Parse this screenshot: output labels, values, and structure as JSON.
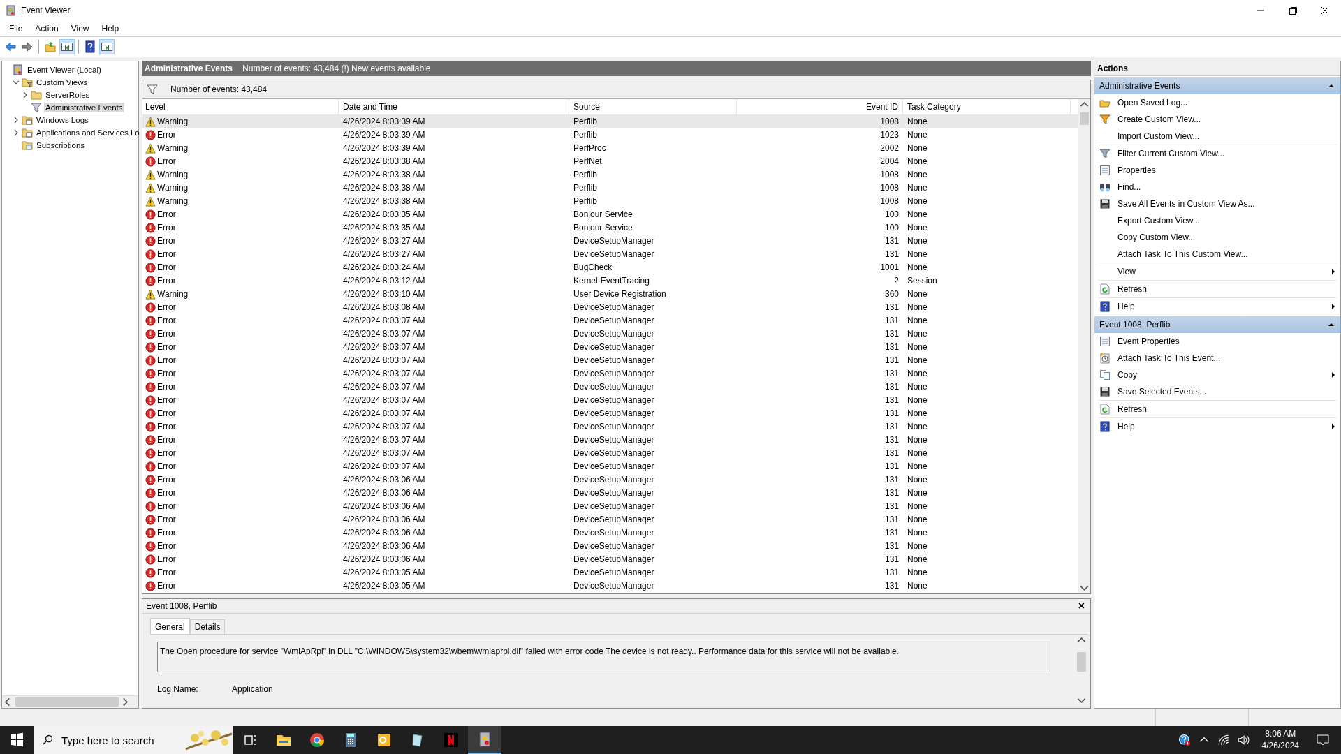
{
  "window": {
    "title": "Event Viewer"
  },
  "menu": [
    "File",
    "Action",
    "View",
    "Help"
  ],
  "toolbar": [
    {
      "kind": "back",
      "pressed": false
    },
    {
      "kind": "forward",
      "pressed": false
    },
    {
      "kind": "up",
      "pressed": false
    },
    {
      "kind": "tree",
      "pressed": true
    },
    {
      "kind": "help",
      "pressed": false
    },
    {
      "kind": "actionpane",
      "pressed": true
    }
  ],
  "tree": [
    {
      "label": "Event Viewer (Local)",
      "kind": "viewer",
      "selected": false,
      "children": [
        {
          "label": "Custom Views",
          "kind": "folderfilter",
          "expanded": true,
          "selected": false,
          "children": [
            {
              "label": "ServerRoles",
              "kind": "folder",
              "expanded": false,
              "selected": false
            },
            {
              "label": "Administrative Events",
              "kind": "filter",
              "selected": true
            }
          ]
        },
        {
          "label": "Windows Logs",
          "kind": "folderlog",
          "expanded": false,
          "selected": false
        },
        {
          "label": "Applications and Services Lo",
          "kind": "folderlog",
          "expanded": false,
          "selected": false
        },
        {
          "label": "Subscriptions",
          "kind": "foldersub",
          "selected": false
        }
      ]
    }
  ],
  "center": {
    "title": "Administrative Events",
    "subtitle": "Number of events: 43,484 (!) New events available",
    "filter_text": "Number of events: 43,484"
  },
  "table": {
    "columns": [
      "Level",
      "Date and Time",
      "Source",
      "Event ID",
      "Task Category"
    ],
    "rows": [
      {
        "kind": "warning",
        "level": "Warning",
        "date": "4/26/2024 8:03:39 AM",
        "source": "Perflib",
        "id": "1008",
        "task": "None",
        "selected": true
      },
      {
        "kind": "error",
        "level": "Error",
        "date": "4/26/2024 8:03:39 AM",
        "source": "Perflib",
        "id": "1023",
        "task": "None",
        "selected": false
      },
      {
        "kind": "warning",
        "level": "Warning",
        "date": "4/26/2024 8:03:39 AM",
        "source": "PerfProc",
        "id": "2002",
        "task": "None",
        "selected": false
      },
      {
        "kind": "error",
        "level": "Error",
        "date": "4/26/2024 8:03:38 AM",
        "source": "PerfNet",
        "id": "2004",
        "task": "None",
        "selected": false
      },
      {
        "kind": "warning",
        "level": "Warning",
        "date": "4/26/2024 8:03:38 AM",
        "source": "Perflib",
        "id": "1008",
        "task": "None",
        "selected": false
      },
      {
        "kind": "warning",
        "level": "Warning",
        "date": "4/26/2024 8:03:38 AM",
        "source": "Perflib",
        "id": "1008",
        "task": "None",
        "selected": false
      },
      {
        "kind": "warning",
        "level": "Warning",
        "date": "4/26/2024 8:03:38 AM",
        "source": "Perflib",
        "id": "1008",
        "task": "None",
        "selected": false
      },
      {
        "kind": "error",
        "level": "Error",
        "date": "4/26/2024 8:03:35 AM",
        "source": "Bonjour Service",
        "id": "100",
        "task": "None",
        "selected": false
      },
      {
        "kind": "error",
        "level": "Error",
        "date": "4/26/2024 8:03:35 AM",
        "source": "Bonjour Service",
        "id": "100",
        "task": "None",
        "selected": false
      },
      {
        "kind": "error",
        "level": "Error",
        "date": "4/26/2024 8:03:27 AM",
        "source": "DeviceSetupManager",
        "id": "131",
        "task": "None",
        "selected": false
      },
      {
        "kind": "error",
        "level": "Error",
        "date": "4/26/2024 8:03:27 AM",
        "source": "DeviceSetupManager",
        "id": "131",
        "task": "None",
        "selected": false
      },
      {
        "kind": "error",
        "level": "Error",
        "date": "4/26/2024 8:03:24 AM",
        "source": "BugCheck",
        "id": "1001",
        "task": "None",
        "selected": false
      },
      {
        "kind": "error",
        "level": "Error",
        "date": "4/26/2024 8:03:12 AM",
        "source": "Kernel-EventTracing",
        "id": "2",
        "task": "Session",
        "selected": false
      },
      {
        "kind": "warning",
        "level": "Warning",
        "date": "4/26/2024 8:03:10 AM",
        "source": "User Device Registration",
        "id": "360",
        "task": "None",
        "selected": false
      },
      {
        "kind": "error",
        "level": "Error",
        "date": "4/26/2024 8:03:08 AM",
        "source": "DeviceSetupManager",
        "id": "131",
        "task": "None",
        "selected": false
      },
      {
        "kind": "error",
        "level": "Error",
        "date": "4/26/2024 8:03:07 AM",
        "source": "DeviceSetupManager",
        "id": "131",
        "task": "None",
        "selected": false
      },
      {
        "kind": "error",
        "level": "Error",
        "date": "4/26/2024 8:03:07 AM",
        "source": "DeviceSetupManager",
        "id": "131",
        "task": "None",
        "selected": false
      },
      {
        "kind": "error",
        "level": "Error",
        "date": "4/26/2024 8:03:07 AM",
        "source": "DeviceSetupManager",
        "id": "131",
        "task": "None",
        "selected": false
      },
      {
        "kind": "error",
        "level": "Error",
        "date": "4/26/2024 8:03:07 AM",
        "source": "DeviceSetupManager",
        "id": "131",
        "task": "None",
        "selected": false
      },
      {
        "kind": "error",
        "level": "Error",
        "date": "4/26/2024 8:03:07 AM",
        "source": "DeviceSetupManager",
        "id": "131",
        "task": "None",
        "selected": false
      },
      {
        "kind": "error",
        "level": "Error",
        "date": "4/26/2024 8:03:07 AM",
        "source": "DeviceSetupManager",
        "id": "131",
        "task": "None",
        "selected": false
      },
      {
        "kind": "error",
        "level": "Error",
        "date": "4/26/2024 8:03:07 AM",
        "source": "DeviceSetupManager",
        "id": "131",
        "task": "None",
        "selected": false
      },
      {
        "kind": "error",
        "level": "Error",
        "date": "4/26/2024 8:03:07 AM",
        "source": "DeviceSetupManager",
        "id": "131",
        "task": "None",
        "selected": false
      },
      {
        "kind": "error",
        "level": "Error",
        "date": "4/26/2024 8:03:07 AM",
        "source": "DeviceSetupManager",
        "id": "131",
        "task": "None",
        "selected": false
      },
      {
        "kind": "error",
        "level": "Error",
        "date": "4/26/2024 8:03:07 AM",
        "source": "DeviceSetupManager",
        "id": "131",
        "task": "None",
        "selected": false
      },
      {
        "kind": "error",
        "level": "Error",
        "date": "4/26/2024 8:03:07 AM",
        "source": "DeviceSetupManager",
        "id": "131",
        "task": "None",
        "selected": false
      },
      {
        "kind": "error",
        "level": "Error",
        "date": "4/26/2024 8:03:07 AM",
        "source": "DeviceSetupManager",
        "id": "131",
        "task": "None",
        "selected": false
      },
      {
        "kind": "error",
        "level": "Error",
        "date": "4/26/2024 8:03:06 AM",
        "source": "DeviceSetupManager",
        "id": "131",
        "task": "None",
        "selected": false
      },
      {
        "kind": "error",
        "level": "Error",
        "date": "4/26/2024 8:03:06 AM",
        "source": "DeviceSetupManager",
        "id": "131",
        "task": "None",
        "selected": false
      },
      {
        "kind": "error",
        "level": "Error",
        "date": "4/26/2024 8:03:06 AM",
        "source": "DeviceSetupManager",
        "id": "131",
        "task": "None",
        "selected": false
      },
      {
        "kind": "error",
        "level": "Error",
        "date": "4/26/2024 8:03:06 AM",
        "source": "DeviceSetupManager",
        "id": "131",
        "task": "None",
        "selected": false
      },
      {
        "kind": "error",
        "level": "Error",
        "date": "4/26/2024 8:03:06 AM",
        "source": "DeviceSetupManager",
        "id": "131",
        "task": "None",
        "selected": false
      },
      {
        "kind": "error",
        "level": "Error",
        "date": "4/26/2024 8:03:06 AM",
        "source": "DeviceSetupManager",
        "id": "131",
        "task": "None",
        "selected": false
      },
      {
        "kind": "error",
        "level": "Error",
        "date": "4/26/2024 8:03:06 AM",
        "source": "DeviceSetupManager",
        "id": "131",
        "task": "None",
        "selected": false
      },
      {
        "kind": "error",
        "level": "Error",
        "date": "4/26/2024 8:03:05 AM",
        "source": "DeviceSetupManager",
        "id": "131",
        "task": "None",
        "selected": false
      },
      {
        "kind": "error",
        "level": "Error",
        "date": "4/26/2024 8:03:05 AM",
        "source": "DeviceSetupManager",
        "id": "131",
        "task": "None",
        "selected": false
      }
    ]
  },
  "details": {
    "title": "Event 1008, Perflib",
    "close": "×",
    "tabs": [
      {
        "label": "General",
        "selected": true
      },
      {
        "label": "Details",
        "selected": false
      }
    ],
    "message": "The Open procedure for service \"WmiApRpl\" in DLL \"C:\\WINDOWS\\system32\\wbem\\wmiaprpl.dll\" failed with error code The device is not ready.. Performance data for this service will not be available.",
    "log_label": "Log Name:",
    "log_value": "Application"
  },
  "actions": {
    "title": "Actions",
    "sections": [
      {
        "title": "Administrative Events",
        "groups": [
          [
            {
              "label": "Open Saved Log...",
              "kind": "folder",
              "submenu": false
            },
            {
              "label": "Create Custom View...",
              "kind": "funnelorange",
              "submenu": false
            },
            {
              "label": "Import Custom View...",
              "kind": "none",
              "submenu": false
            }
          ],
          [
            {
              "label": "Filter Current Custom View...",
              "kind": "funnel",
              "submenu": false
            },
            {
              "label": "Properties",
              "kind": "properties",
              "submenu": false
            },
            {
              "label": "Find...",
              "kind": "binoculars",
              "submenu": false
            },
            {
              "label": "Save All Events in Custom View As...",
              "kind": "floppy",
              "submenu": false
            },
            {
              "label": "Export Custom View...",
              "kind": "none",
              "submenu": false
            },
            {
              "label": "Copy Custom View...",
              "kind": "none",
              "submenu": false
            },
            {
              "label": "Attach Task To This Custom View...",
              "kind": "none",
              "submenu": false
            }
          ],
          [
            {
              "label": "View",
              "kind": "none",
              "submenu": true
            }
          ],
          [
            {
              "label": "Refresh",
              "kind": "refresh",
              "submenu": false
            }
          ],
          [
            {
              "label": "Help",
              "kind": "help",
              "submenu": true
            }
          ]
        ]
      },
      {
        "title": "Event 1008, Perflib",
        "groups": [
          [
            {
              "label": "Event Properties",
              "kind": "properties",
              "submenu": false
            },
            {
              "label": "Attach Task To This Event...",
              "kind": "task",
              "submenu": false
            },
            {
              "label": "Copy",
              "kind": "copy",
              "submenu": true
            },
            {
              "label": "Save Selected Events...",
              "kind": "floppy",
              "submenu": false
            }
          ],
          [
            {
              "label": "Refresh",
              "kind": "refresh",
              "submenu": false
            }
          ],
          [
            {
              "label": "Help",
              "kind": "help",
              "submenu": true
            }
          ]
        ]
      }
    ]
  },
  "taskbar": {
    "search_placeholder": "Type here to search",
    "apps": [
      {
        "kind": "taskview",
        "selected": false
      },
      {
        "kind": "explorer",
        "selected": false
      },
      {
        "kind": "chrome",
        "selected": false
      },
      {
        "kind": "calculator",
        "selected": false
      },
      {
        "kind": "outlook",
        "selected": false
      },
      {
        "kind": "notepad",
        "selected": false
      },
      {
        "kind": "netflix",
        "selected": false
      },
      {
        "kind": "eventviewer",
        "selected": true
      }
    ],
    "time": "8:06 AM",
    "date": "4/26/2024"
  }
}
